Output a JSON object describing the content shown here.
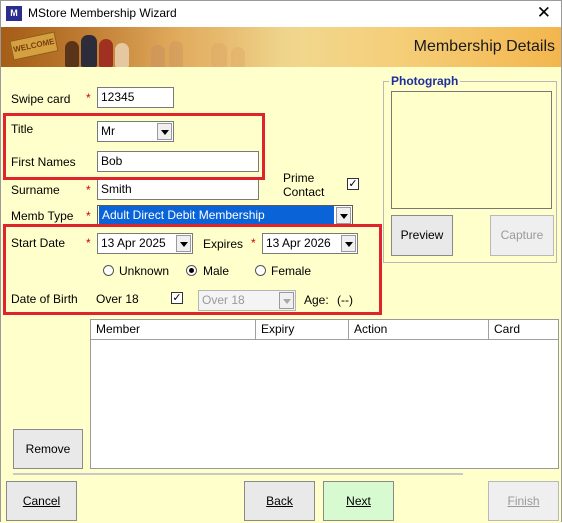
{
  "window": {
    "title": "MStore Membership Wizard",
    "icon_text": "M",
    "close_symbol": "✕"
  },
  "banner": {
    "title": "Membership Details",
    "sign_text": "WELCOME"
  },
  "form": {
    "swipe_card": {
      "label": "Swipe card",
      "required_mark": "*",
      "value": "12345"
    },
    "title": {
      "label": "Title",
      "value": "Mr"
    },
    "first_names": {
      "label": "First Names",
      "value": "Bob"
    },
    "surname": {
      "label": "Surname",
      "required_mark": "*",
      "value": "Smith"
    },
    "prime_contact": {
      "label_line1": "Prime",
      "label_line2": "Contact",
      "checked": true,
      "check_mark": "✓"
    },
    "memb_type": {
      "label": "Memb Type",
      "required_mark": "*",
      "value": "Adult Direct Debit Membership"
    },
    "start_date": {
      "label": "Start Date",
      "required_mark": "*",
      "value": "13  Apr  2025"
    },
    "expires": {
      "label": "Expires",
      "required_mark": "*",
      "value": "13  Apr  2026"
    },
    "gender": {
      "options": [
        "Unknown",
        "Male",
        "Female"
      ],
      "selected": "Male"
    },
    "date_of_birth": {
      "label": "Date of Birth",
      "value_text": "Over 18",
      "over18_checked": true,
      "check_mark": "✓",
      "combo_value": "Over 18",
      "age_label": "Age:",
      "age_value": "(--)"
    }
  },
  "photograph": {
    "group_title": "Photograph",
    "preview_label": "Preview",
    "capture_label": "Capture"
  },
  "members_table": {
    "columns": [
      "Member",
      "Expiry",
      "Action",
      "Card"
    ],
    "rows": []
  },
  "buttons": {
    "remove": "Remove",
    "cancel": "Cancel",
    "back": "Back",
    "next": "Next",
    "finish": "Finish"
  },
  "colors": {
    "background": "#ffffcc",
    "highlight_border": "#e0242c",
    "selection_blue": "#0a64d8",
    "required_red": "#d00000",
    "next_button": "#d8fad0"
  }
}
